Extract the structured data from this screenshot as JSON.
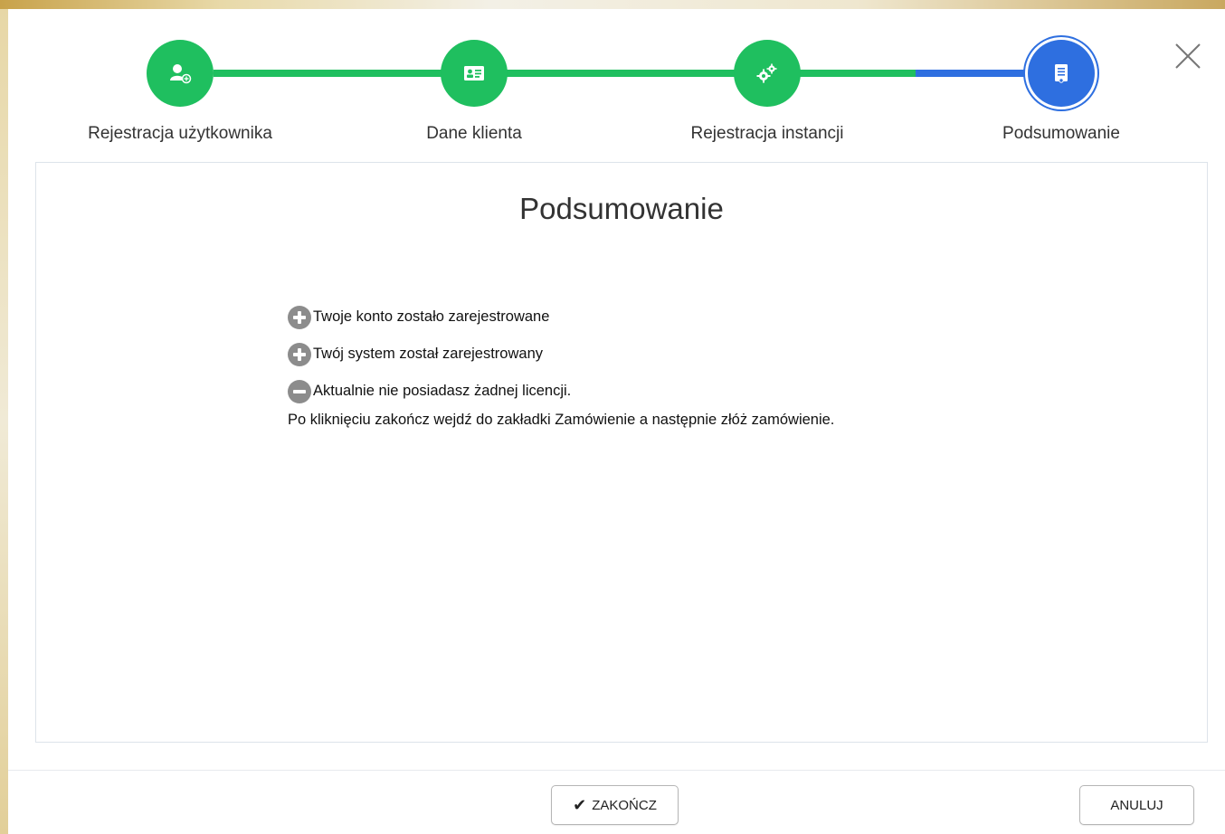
{
  "wizard": {
    "steps": [
      {
        "label": "Rejestracja użytkownika",
        "icon": "user-add-icon",
        "state": "done"
      },
      {
        "label": "Dane klienta",
        "icon": "id-card-icon",
        "state": "done"
      },
      {
        "label": "Rejestracja instancji",
        "icon": "gears-icon",
        "state": "done"
      },
      {
        "label": "Podsumowanie",
        "icon": "document-icon",
        "state": "active"
      }
    ],
    "colors": {
      "done": "#1fbf5f",
      "active": "#2e6fe0"
    }
  },
  "panel": {
    "title": "Podsumowanie",
    "items": [
      {
        "icon": "plus-circle-icon",
        "text": "Twoje konto zostało zarejestrowane"
      },
      {
        "icon": "plus-circle-icon",
        "text": "Twój system został zarejestrowany"
      },
      {
        "icon": "minus-circle-icon",
        "text": "Aktualnie nie posiadasz żadnej licencji."
      }
    ],
    "instruction": "Po kliknięciu zakończ wejdź do zakładki Zamówienie a następnie złóż zamówienie."
  },
  "footer": {
    "finish_label": "ZAKOŃCZ",
    "cancel_label": "ANULUJ"
  }
}
